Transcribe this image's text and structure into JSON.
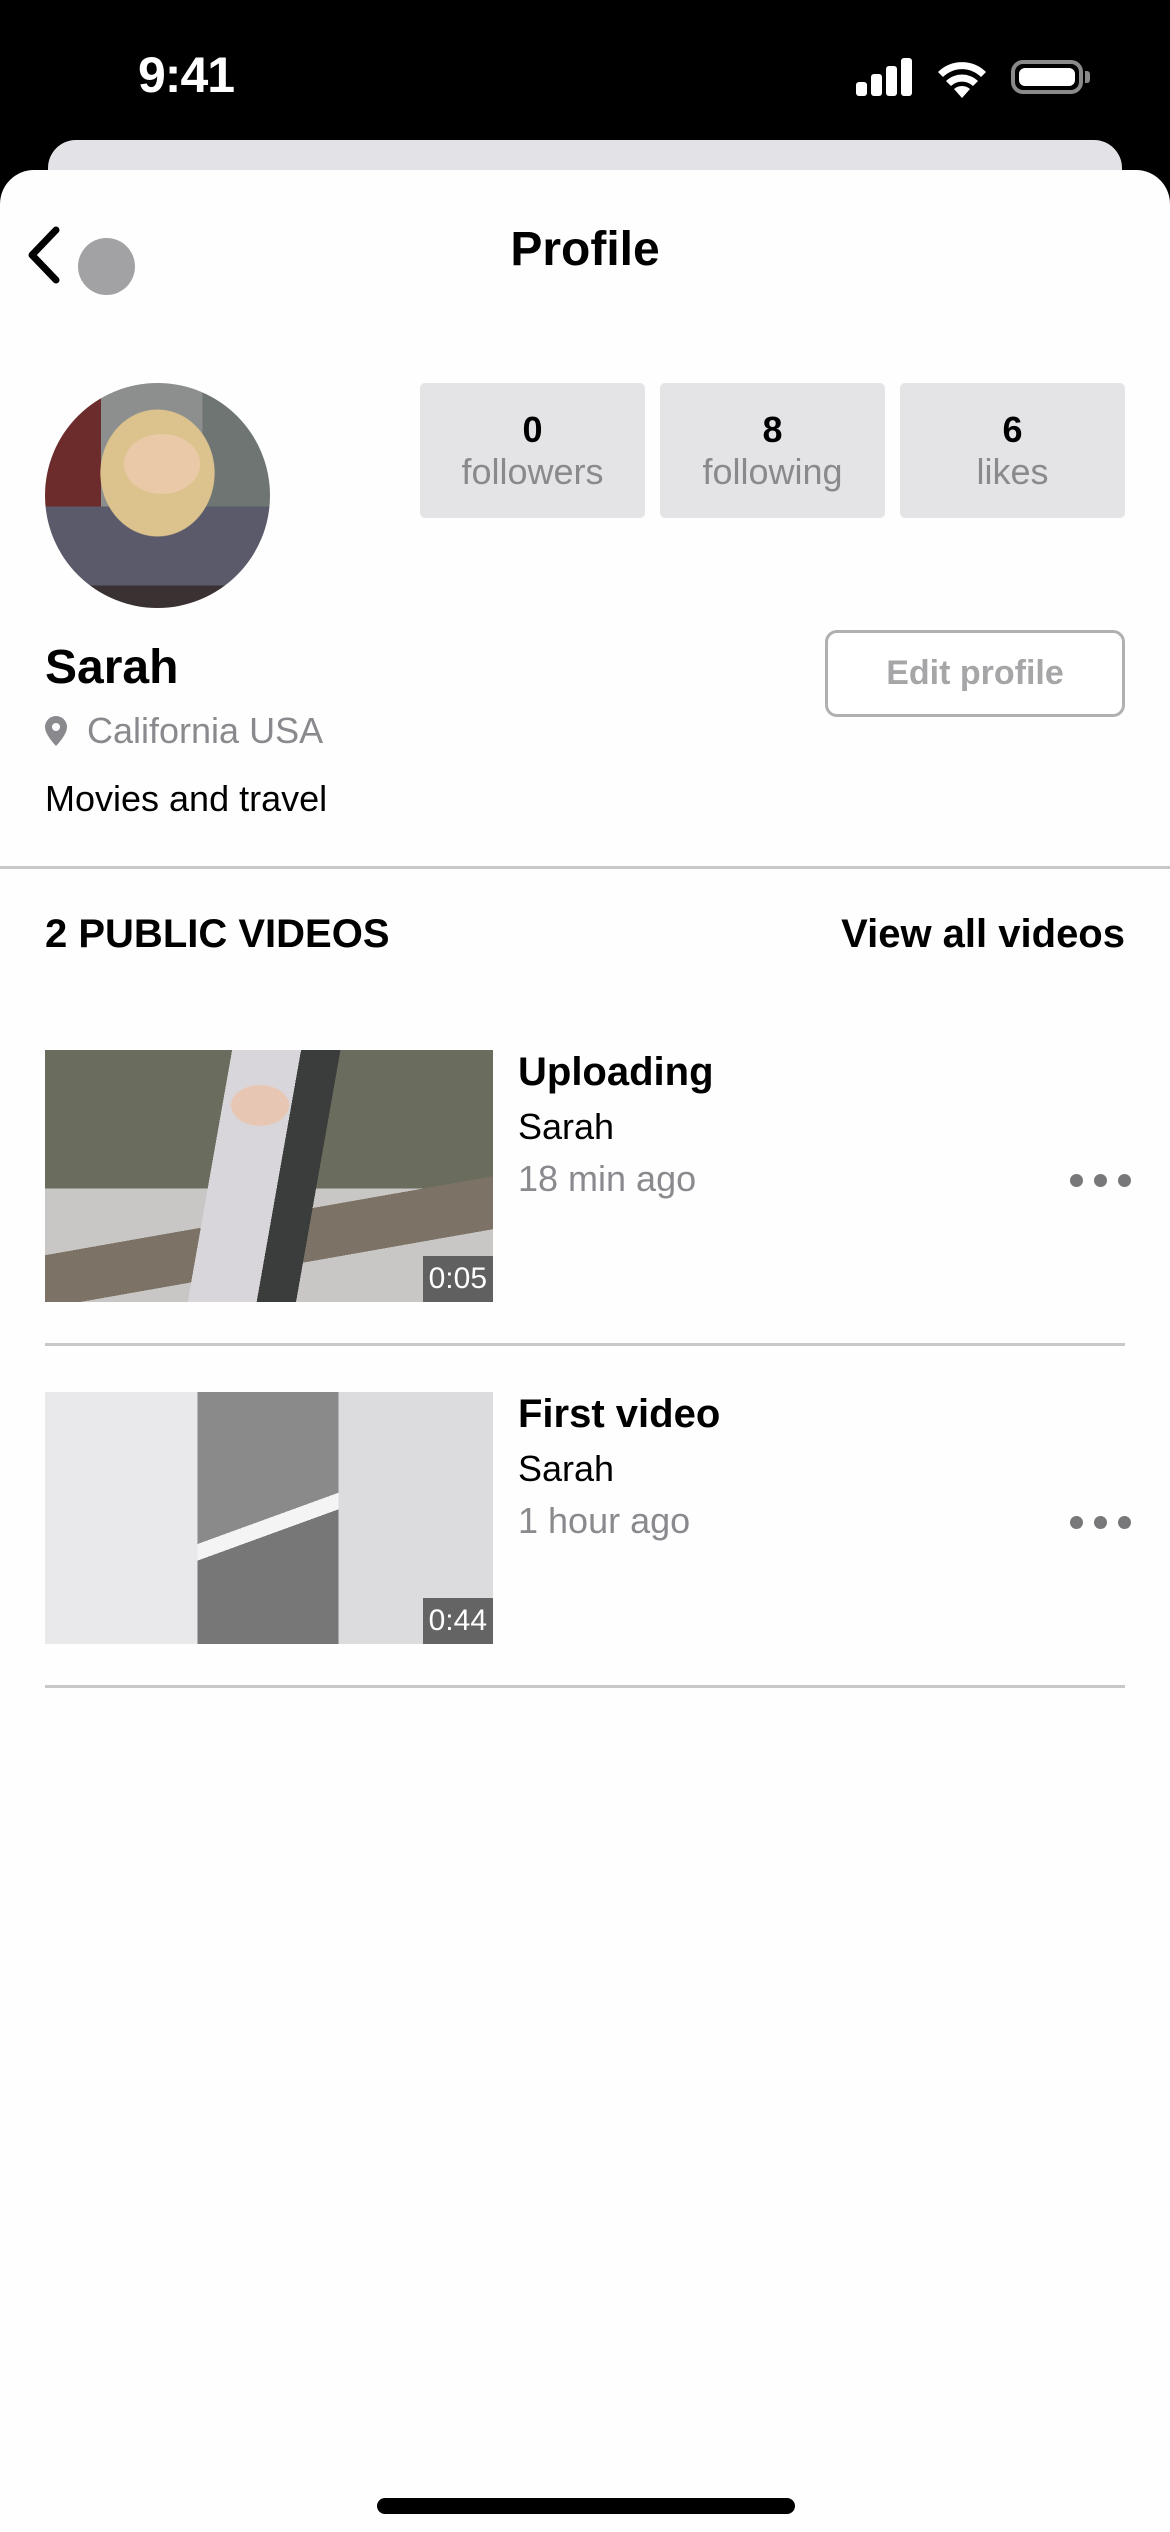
{
  "status_bar": {
    "time": "9:41",
    "icons": [
      "cellular-signal-icon",
      "wifi-icon",
      "battery-icon"
    ]
  },
  "nav": {
    "back_icon": "chevron-left-icon",
    "title": "Profile"
  },
  "profile": {
    "name": "Sarah",
    "location": "California USA",
    "location_icon": "map-pin-icon",
    "bio": "Movies and travel",
    "edit_button_label": "Edit profile",
    "stats": [
      {
        "value": "0",
        "label": "followers"
      },
      {
        "value": "8",
        "label": "following"
      },
      {
        "value": "6",
        "label": "likes"
      }
    ]
  },
  "videos_section": {
    "title": "2 PUBLIC VIDEOS",
    "view_all_label": "View all videos",
    "items": [
      {
        "title": "Uploading",
        "author": "Sarah",
        "time": "18 min ago",
        "duration": "0:05"
      },
      {
        "title": "First video",
        "author": "Sarah",
        "time": "1 hour ago",
        "duration": "0:44"
      }
    ]
  },
  "colors": {
    "stat_bg": "#e4e3e6",
    "secondary_text": "#8a8a8e",
    "divider": "#c8c8c8",
    "nav_dot": "#a2a1a3"
  }
}
